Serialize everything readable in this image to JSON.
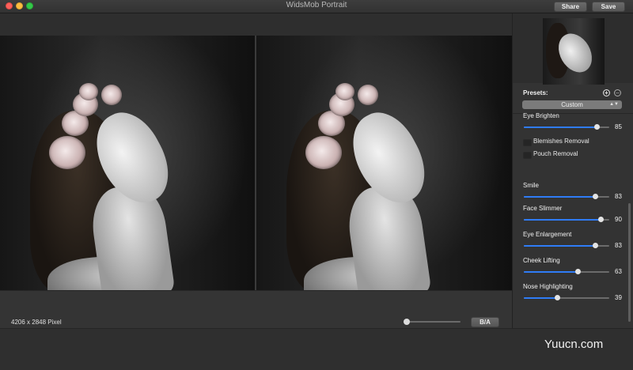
{
  "window": {
    "title": "WidsMob Portrait",
    "share_label": "Share",
    "save_label": "Save"
  },
  "status": {
    "pixel_info": "4206 x 2848 Pixel",
    "ba_label": "B/A",
    "zoom_level": 0.05
  },
  "panel": {
    "presets_label": "Presets:",
    "preset_value": "Custom",
    "eye_brighten": {
      "label": "Eye Brighten",
      "value": "85",
      "level": 0.85
    },
    "checkboxes": [
      {
        "label": "Blemishes Removal",
        "checked": false
      },
      {
        "label": "Pouch Removal",
        "checked": false
      }
    ],
    "sliders": [
      {
        "label": "Smile",
        "value": "83",
        "level": 0.83
      },
      {
        "label": "Face Slimmer",
        "value": "90",
        "level": 0.9
      },
      {
        "label": "Eye Enlargement",
        "value": "83",
        "level": 0.83
      },
      {
        "label": "Cheek Lifting",
        "value": "63",
        "level": 0.63
      },
      {
        "label": "Nose Highlighting",
        "value": "39",
        "level": 0.39
      }
    ]
  },
  "watermark": "Yuucn.com",
  "colors": {
    "accent": "#2f7cf6",
    "background": "#2b2b2b",
    "panel": "#333333"
  }
}
